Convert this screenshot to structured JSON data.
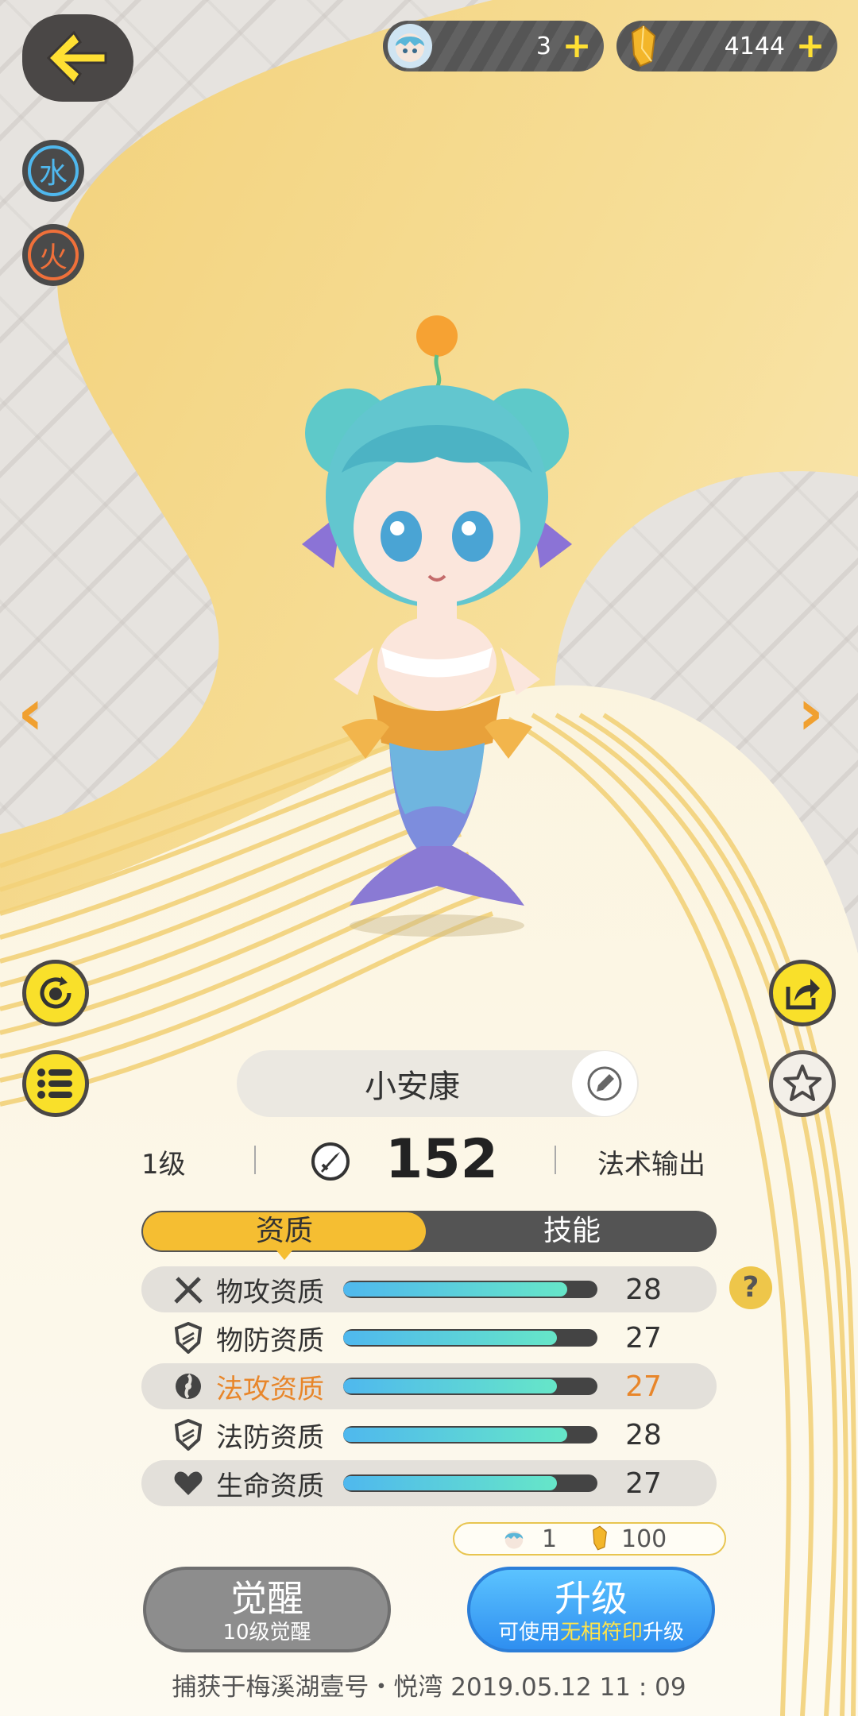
{
  "resources": {
    "pets": {
      "value": "3",
      "icon": "pet-head-icon"
    },
    "crystals": {
      "value": "4144",
      "icon": "gold-crystal-icon"
    }
  },
  "elements": [
    {
      "label": "水",
      "color": "#4fb8ee"
    },
    {
      "label": "火",
      "color": "#f0703a"
    }
  ],
  "pet": {
    "name": "小安康",
    "level": "1级",
    "power": "152",
    "role": "法术输出"
  },
  "tabs": {
    "active": "资质",
    "other": "技能"
  },
  "stats": [
    {
      "label": "物攻资质",
      "value": "28",
      "fill": 0.88,
      "icon": "swords-icon",
      "highlight": false
    },
    {
      "label": "物防资质",
      "value": "27",
      "fill": 0.84,
      "icon": "shield-icon",
      "highlight": false
    },
    {
      "label": "法攻资质",
      "value": "27",
      "fill": 0.84,
      "icon": "magic-orb-icon",
      "highlight": true
    },
    {
      "label": "法防资质",
      "value": "28",
      "fill": 0.88,
      "icon": "shield-icon",
      "highlight": false
    },
    {
      "label": "生命资质",
      "value": "27",
      "fill": 0.84,
      "icon": "heart-icon",
      "highlight": false
    }
  ],
  "help": "?",
  "cost": {
    "pets": "1",
    "crystals": "100"
  },
  "buttons": {
    "awaken": {
      "title": "觉醒",
      "sub": "10级觉醒"
    },
    "upgrade": {
      "title": "升级",
      "sub_pre": "可使用",
      "sub_hl": "无相符印",
      "sub_post": "升级"
    }
  },
  "footer": "捕获于梅溪湖壹号・悦湾 2019.05.12 11 : 09",
  "colors": {
    "accent": "#f5be32",
    "button_yellow": "#f9e02a",
    "highlight": "#e8862a"
  }
}
